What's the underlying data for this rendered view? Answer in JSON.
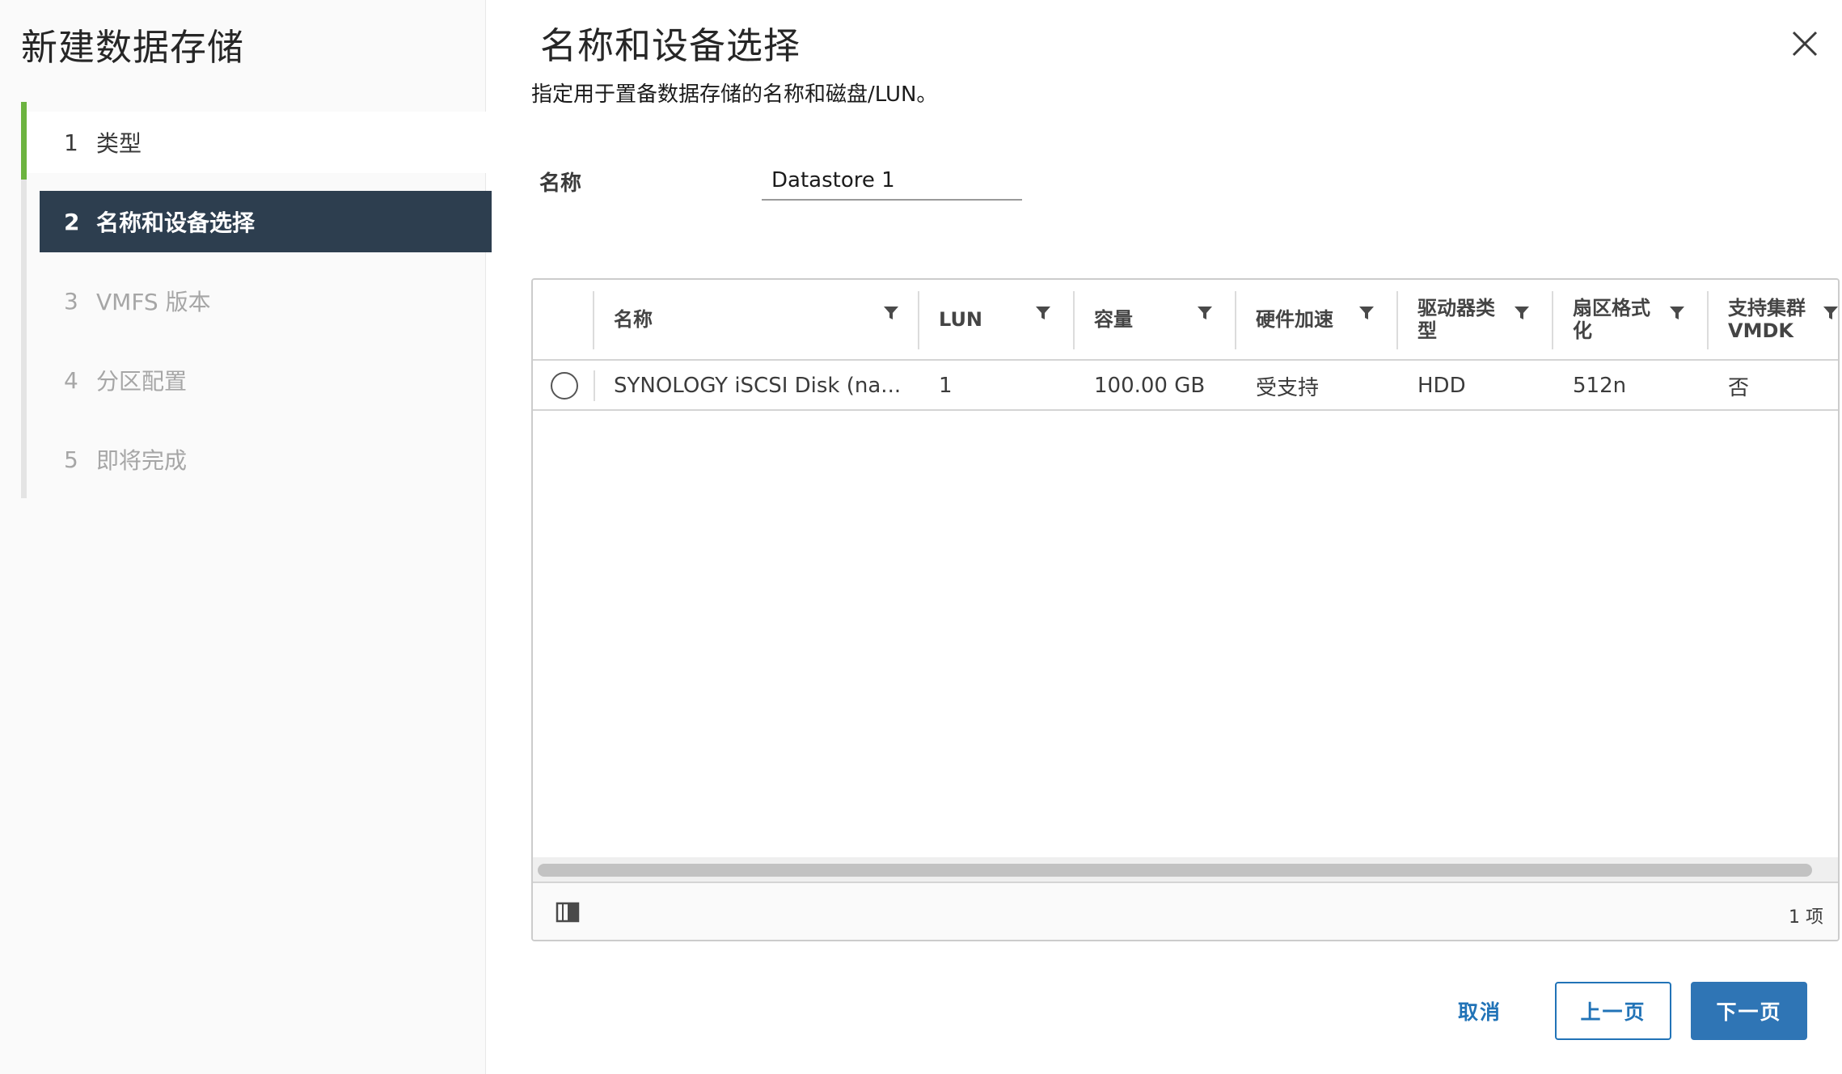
{
  "wizard": {
    "title": "新建数据存储",
    "steps": [
      {
        "num": "1",
        "label": "类型",
        "state": "done"
      },
      {
        "num": "2",
        "label": "名称和设备选择",
        "state": "active"
      },
      {
        "num": "3",
        "label": "VMFS 版本",
        "state": "pending"
      },
      {
        "num": "4",
        "label": "分区配置",
        "state": "pending"
      },
      {
        "num": "5",
        "label": "即将完成",
        "state": "pending"
      }
    ]
  },
  "page": {
    "title": "名称和设备选择",
    "subtitle": "指定用于置备数据存储的名称和磁盘/LUN。",
    "name_label": "名称",
    "name_value": "Datastore 1"
  },
  "grid": {
    "columns": [
      "名称",
      "LUN",
      "容量",
      "硬件加速",
      "驱动器类型",
      "扇区格式化",
      "支持集群 VMDK"
    ],
    "rows": [
      [
        "SYNOLOGY iSCSI Disk (na...",
        "1",
        "100.00 GB",
        "受支持",
        "HDD",
        "512n",
        "否"
      ]
    ],
    "footer_count": "1 项"
  },
  "buttons": {
    "cancel": "取消",
    "back": "上一页",
    "next": "下一页"
  },
  "colors": {
    "active_step_bg": "#2d3e4f",
    "done_bar": "#6cb33f",
    "primary": "#2f75b5"
  }
}
